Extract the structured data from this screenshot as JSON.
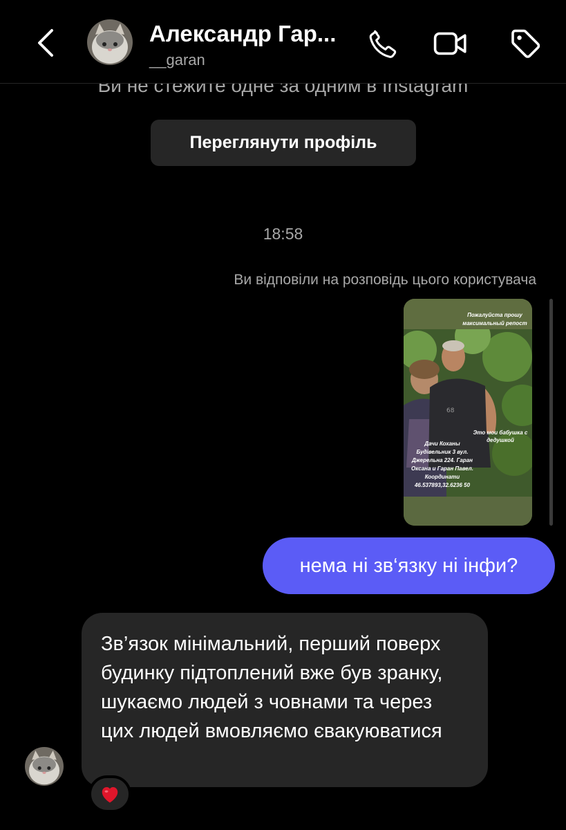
{
  "header": {
    "contact_name": "Александр Гар...",
    "username": "__garan"
  },
  "conversation": {
    "follow_notice": "Ви не стежите одне за одним в Instagram",
    "view_profile_label": "Переглянути профіль",
    "timestamp": "18:58",
    "story_reply_note": "Ви відповіли на розповідь цього користувача",
    "story": {
      "caption_top": "Пожалуйста прошу максимальный репост",
      "caption_mid": "Это мои бабушка с дедушкой",
      "caption_bottom": "Дачи Коханы Будівельник 3 вул. Джерельна 224. Гаран Оксана и Гаран Павел. Координати 46.537893,32.6236 50"
    },
    "outgoing_message": "нема ні зв‘язку ні інфи?",
    "incoming_message": "Зв’язок мінімальний, перший поверх будинку підтоплений вже був зранку, шукаємо людей з човнами та через цих людей вмовляємо євакуюватися",
    "reaction": "❤️"
  },
  "colors": {
    "background": "#000000",
    "outgoing_bubble": "#5b5cf6",
    "incoming_bubble": "#262626",
    "secondary_text": "#a8a8a8"
  },
  "icons": [
    "chevron-left-icon",
    "phone-icon",
    "video-camera-icon",
    "tag-icon",
    "heart-icon"
  ]
}
